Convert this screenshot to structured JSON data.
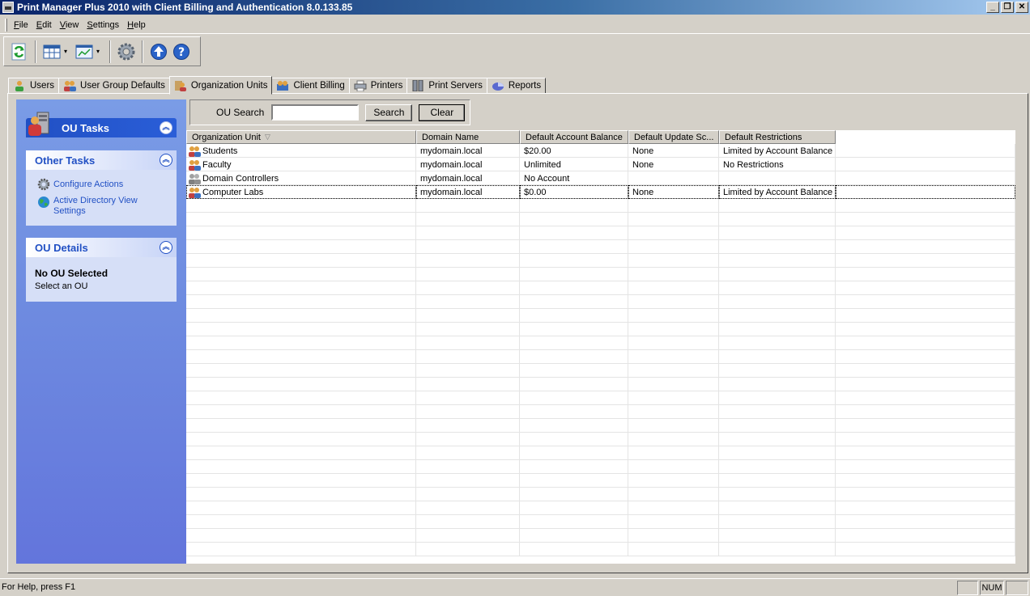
{
  "window": {
    "title": "Print Manager Plus 2010 with Client Billing and Authentication 8.0.133.85",
    "minimize": "_",
    "restore": "❐",
    "close": "✕"
  },
  "menu": [
    {
      "label": "File",
      "key": "F",
      "rest": "ile"
    },
    {
      "label": "Edit",
      "key": "E",
      "rest": "dit"
    },
    {
      "label": "View",
      "key": "V",
      "rest": "iew"
    },
    {
      "label": "Settings",
      "key": "S",
      "rest": "ettings"
    },
    {
      "label": "Help",
      "key": "H",
      "rest": "elp"
    }
  ],
  "toolbar": {
    "icons": [
      "refresh-icon",
      "columns-icon",
      "export-icon",
      "settings-gear-icon",
      "upgrade-icon",
      "help-icon"
    ],
    "dropdown_glyph": "▾"
  },
  "tabs": [
    {
      "label": "Users",
      "icon": "user-icon"
    },
    {
      "label": "User Group Defaults",
      "icon": "user-group-icon"
    },
    {
      "label": "Organization Units",
      "icon": "organization-unit-icon",
      "active": true
    },
    {
      "label": "Client Billing",
      "icon": "client-billing-icon"
    },
    {
      "label": "Printers",
      "icon": "printer-icon"
    },
    {
      "label": "Print Servers",
      "icon": "print-server-icon"
    },
    {
      "label": "Reports",
      "icon": "reports-icon"
    }
  ],
  "sidebar": {
    "ou_tasks_title": "OU Tasks",
    "collapse_glyph": "︽",
    "other_tasks": {
      "title": "Other Tasks",
      "links": [
        {
          "label": "Configure Actions",
          "icon": "gear-icon"
        },
        {
          "label": "Active Directory View Settings",
          "icon": "globe-icon"
        }
      ]
    },
    "ou_details": {
      "title": "OU Details",
      "heading": "No OU Selected",
      "text": "Select an OU"
    }
  },
  "search": {
    "label": "OU Search",
    "value": "",
    "search_button": "Search",
    "clear_button": "Clear"
  },
  "grid": {
    "sort_glyph": "▽",
    "columns": [
      "Organization Unit",
      "Domain Name",
      "Default Account Balance",
      "Default Update Sc...",
      "Default Restrictions"
    ],
    "rows": [
      {
        "ou": "Students",
        "domain": "mydomain.local",
        "balance": "$20.00",
        "update": "None",
        "restrictions": "Limited by Account Balance",
        "icon": "ou-group-icon"
      },
      {
        "ou": "Faculty",
        "domain": "mydomain.local",
        "balance": "Unlimited",
        "update": "None",
        "restrictions": "No Restrictions",
        "icon": "ou-group-icon"
      },
      {
        "ou": "Domain Controllers",
        "domain": "mydomain.local",
        "balance": "No Account",
        "update": "",
        "restrictions": "",
        "icon": "ou-group-gray-icon"
      },
      {
        "ou": "Computer Labs",
        "domain": "mydomain.local",
        "balance": "$0.00",
        "update": "None",
        "restrictions": "Limited by Account Balance",
        "icon": "ou-group-icon",
        "focused": true
      }
    ]
  },
  "status": {
    "text": "For Help, press F1",
    "num": "NUM"
  }
}
